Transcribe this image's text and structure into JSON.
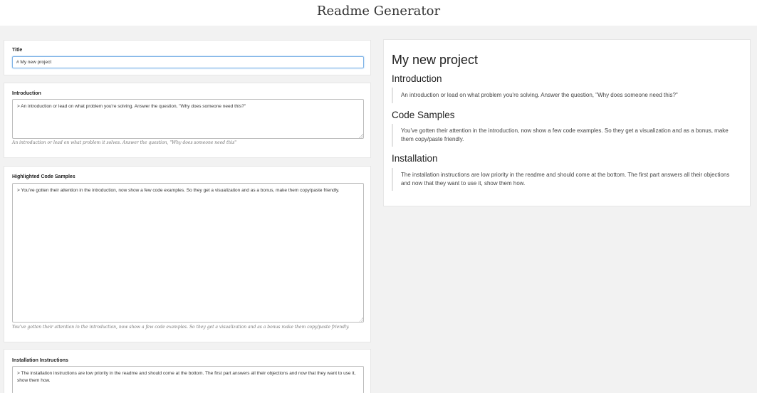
{
  "app": {
    "title": "Readme Generator"
  },
  "editor": {
    "title_field": {
      "label": "Title",
      "value": "# My new project"
    },
    "introduction_field": {
      "label": "Introduction",
      "value": "> An introduction or lead on what problem you're solving. Answer the question, \"Why does someone need this?\"",
      "help": "An introduction or lead on what problem it solves. Answer the question, \"Why does someone need this\""
    },
    "code_samples_field": {
      "label": "Highlighted Code Samples",
      "value": "> You've gotten their attention in the introduction, now show a few code examples. So they get a visualization and as a bonus, make them copy/paste friendly.",
      "help": "You've gotten their attention in the introduction, now show a few code examples. So they get a visualization and as a bonus make them copy/paste friendly."
    },
    "installation_field": {
      "label": "Installation Instructions",
      "value": "> The installation instructions are low priority in the readme and should come at the bottom. The first part answers all their objections and now that they want to use it, show them how."
    }
  },
  "preview": {
    "title": "My new project",
    "sections": [
      {
        "heading": "Introduction",
        "quote": "An introduction or lead on what problem you're solving. Answer the question, \"Why does someone need this?\""
      },
      {
        "heading": "Code Samples",
        "quote": "You've gotten their attention in the introduction, now show a few code examples. So they get a visualization and as a bonus, make them copy/paste friendly."
      },
      {
        "heading": "Installation",
        "quote": "The installation instructions are low priority in the readme and should come at the bottom. The first part answers all their objections and now that they want to use it, show them how."
      }
    ]
  }
}
